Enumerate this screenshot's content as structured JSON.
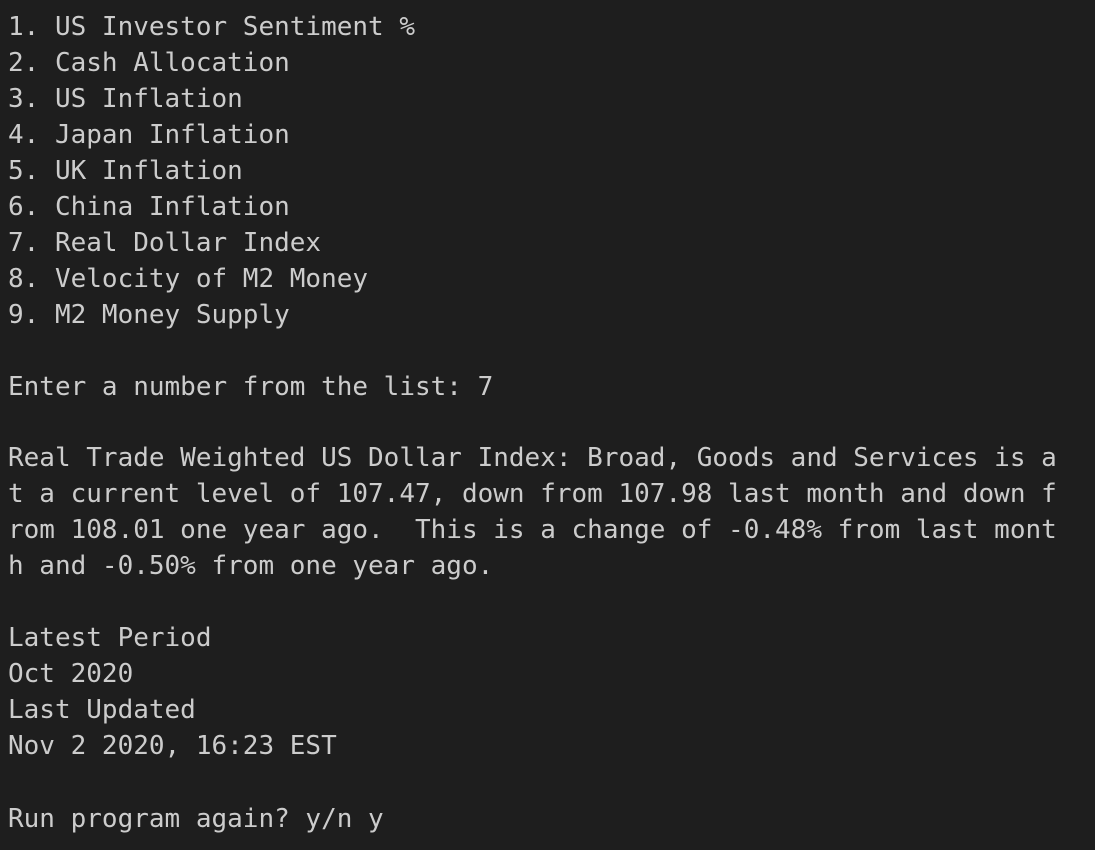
{
  "menu": {
    "items": [
      "1. US Investor Sentiment %",
      "2. Cash Allocation",
      "3. US Inflation",
      "4. Japan Inflation",
      "5. UK Inflation",
      "6. China Inflation",
      "7. Real Dollar Index",
      "8. Velocity of M2 Money",
      "9. M2 Money Supply"
    ]
  },
  "prompt": {
    "label": "Enter a number from the list: ",
    "value": "7"
  },
  "result": {
    "lines": [
      "Real Trade Weighted US Dollar Index: Broad, Goods and Services is a",
      "t a current level of 107.47, down from 107.98 last month and down f",
      "rom 108.01 one year ago.  This is a change of -0.48% from last mont",
      "h and -0.50% from one year ago."
    ]
  },
  "meta": {
    "latest_period_label": "Latest Period",
    "latest_period_value": "Oct 2020",
    "last_updated_label": "Last Updated",
    "last_updated_value": "Nov 2 2020, 16:23 EST"
  },
  "rerun": {
    "label": "Run program again? y/n ",
    "value": "y"
  },
  "colors": {
    "background": "#1e1e1e",
    "text": "#cccccc"
  }
}
